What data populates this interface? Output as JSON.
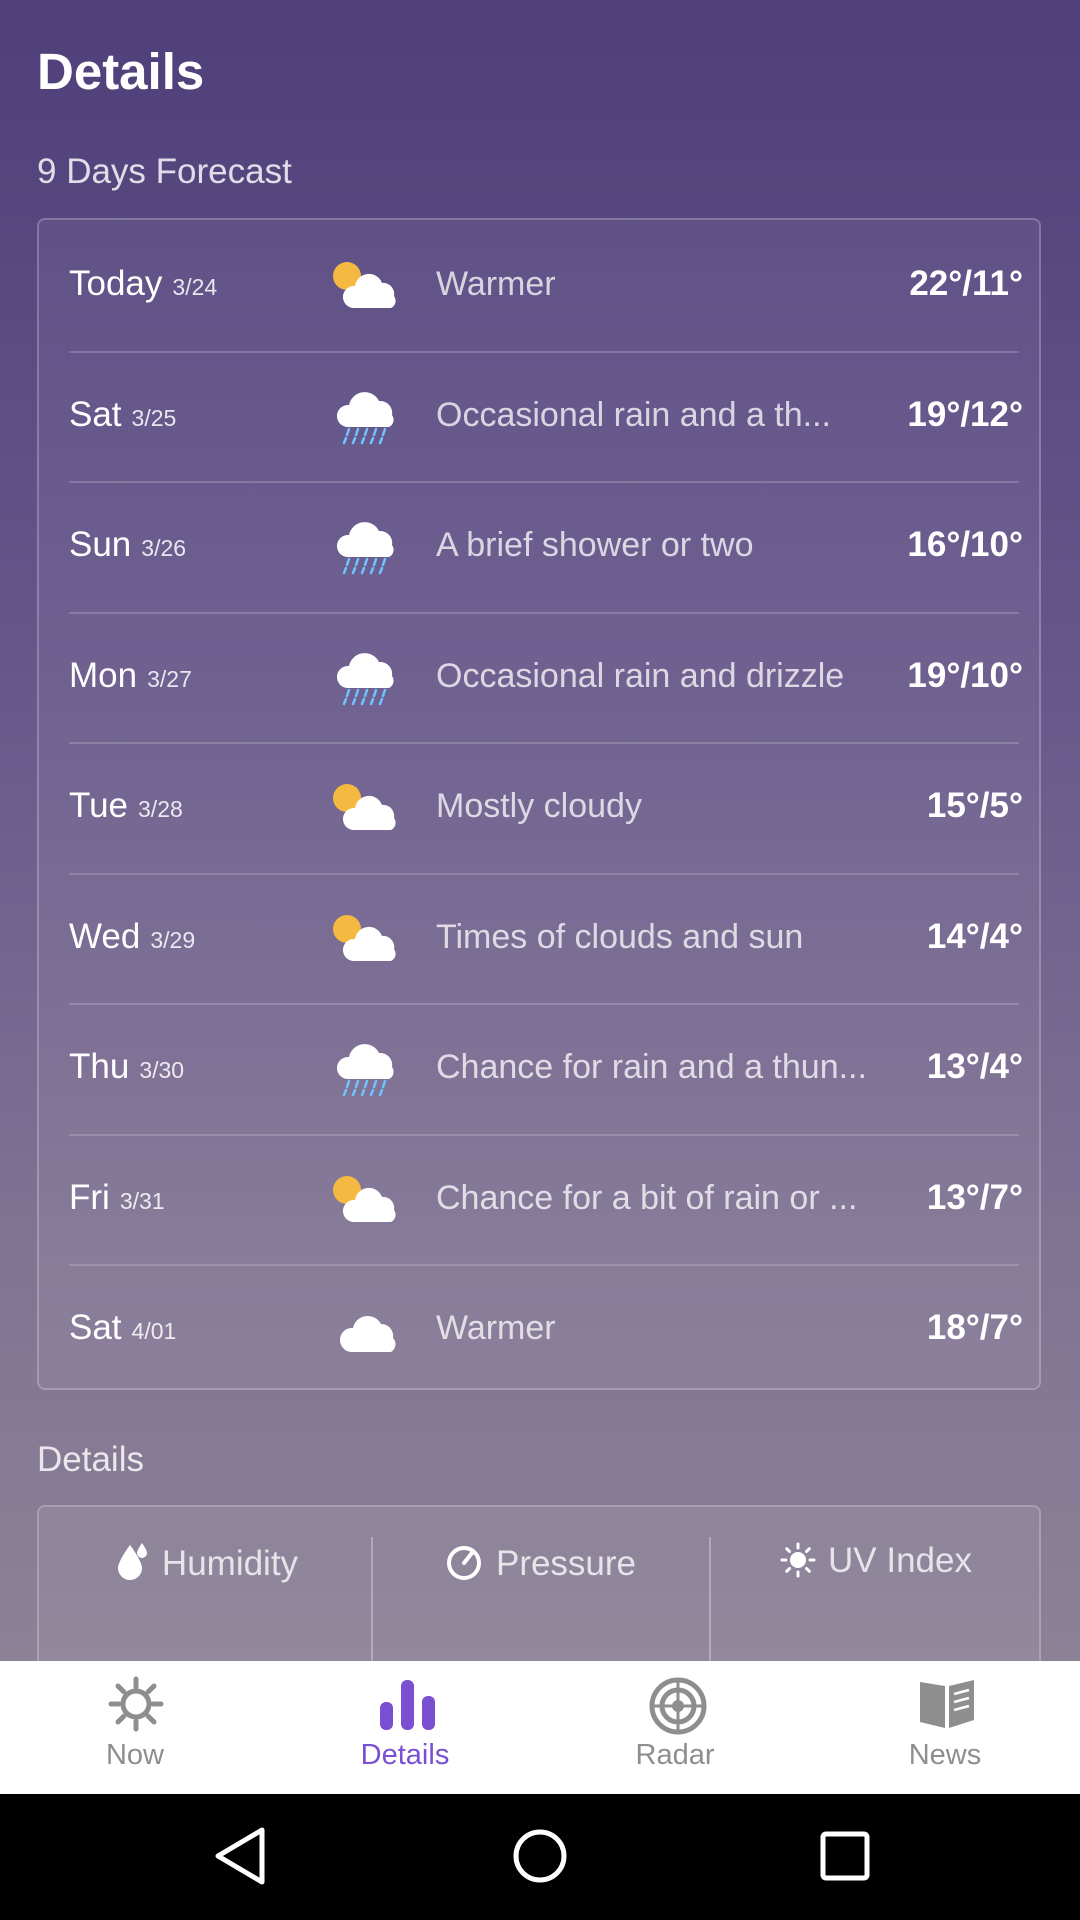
{
  "header": {
    "title": "Details"
  },
  "forecast": {
    "section_title": "9 Days Forecast",
    "days": [
      {
        "day": "Today",
        "date": "3/24",
        "icon": "partly-cloudy-icon",
        "desc": "Warmer",
        "temp": "22°/11°"
      },
      {
        "day": "Sat",
        "date": "3/25",
        "icon": "rain-icon",
        "desc": "Occasional rain and a th...",
        "temp": "19°/12°"
      },
      {
        "day": "Sun",
        "date": "3/26",
        "icon": "rain-icon",
        "desc": "A brief shower or two",
        "temp": "16°/10°"
      },
      {
        "day": "Mon",
        "date": "3/27",
        "icon": "rain-icon",
        "desc": "Occasional rain and drizzle",
        "temp": "19°/10°"
      },
      {
        "day": "Tue",
        "date": "3/28",
        "icon": "partly-cloudy-icon",
        "desc": "Mostly cloudy",
        "temp": "15°/5°"
      },
      {
        "day": "Wed",
        "date": "3/29",
        "icon": "partly-cloudy-icon",
        "desc": "Times of clouds and sun",
        "temp": "14°/4°"
      },
      {
        "day": "Thu",
        "date": "3/30",
        "icon": "rain-icon",
        "desc": "Chance for rain and a thun...",
        "temp": "13°/4°"
      },
      {
        "day": "Fri",
        "date": "3/31",
        "icon": "partly-cloudy-icon",
        "desc": "Chance for a bit of rain or ...",
        "temp": "13°/7°"
      },
      {
        "day": "Sat",
        "date": "4/01",
        "icon": "cloud-icon",
        "desc": "Warmer",
        "temp": "18°/7°"
      }
    ]
  },
  "details": {
    "section_title": "Details",
    "tabs": [
      {
        "label": "Humidity",
        "icon": "droplet-icon"
      },
      {
        "label": "Pressure",
        "icon": "gauge-icon"
      },
      {
        "label": "UV Index",
        "icon": "sun-icon"
      }
    ]
  },
  "nav": {
    "items": [
      {
        "label": "Now",
        "icon": "sun-gear-icon",
        "active": false
      },
      {
        "label": "Details",
        "icon": "bar-chart-icon",
        "active": true
      },
      {
        "label": "Radar",
        "icon": "radar-icon",
        "active": false
      },
      {
        "label": "News",
        "icon": "book-icon",
        "active": false
      }
    ]
  },
  "colors": {
    "active": "#7a4fd1",
    "inactive": "#8e8e8e",
    "sun": "#f5b942",
    "rain": "#6fc3ff"
  }
}
